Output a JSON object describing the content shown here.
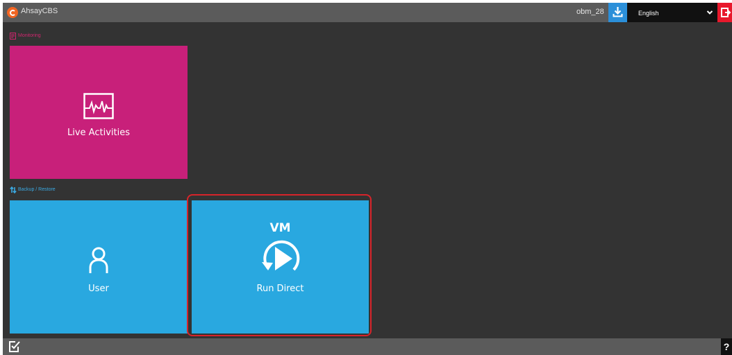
{
  "header": {
    "app_title": "AhsayCBS",
    "username": "obm_28",
    "language": "English",
    "icons": {
      "logo": "ahsay-logo-icon",
      "download": "download-icon",
      "chevron": "chevron-down-icon",
      "logout": "logout-icon"
    }
  },
  "sections": {
    "monitoring": {
      "label": "Monitoring",
      "icon": "monitor-report-icon",
      "tiles": [
        {
          "label": "Live Activities",
          "icon": "pulse-monitor-icon"
        }
      ]
    },
    "backup_restore": {
      "label": "Backup / Restore",
      "icon": "sync-arrows-icon",
      "tiles": [
        {
          "label": "User",
          "icon": "user-icon"
        },
        {
          "label": "Run Direct",
          "icon": "vm-run-direct-icon",
          "badge": "VM"
        }
      ]
    }
  },
  "footer": {
    "tasks_icon": "checklist-icon",
    "help_label": "?"
  },
  "colors": {
    "background": "#333333",
    "bar": "#5b5b5b",
    "monitoring": "#c8207a",
    "backup": "#29a8e0",
    "highlight": "#d7242a",
    "logout": "#e8192c",
    "download": "#2b8fd9"
  }
}
